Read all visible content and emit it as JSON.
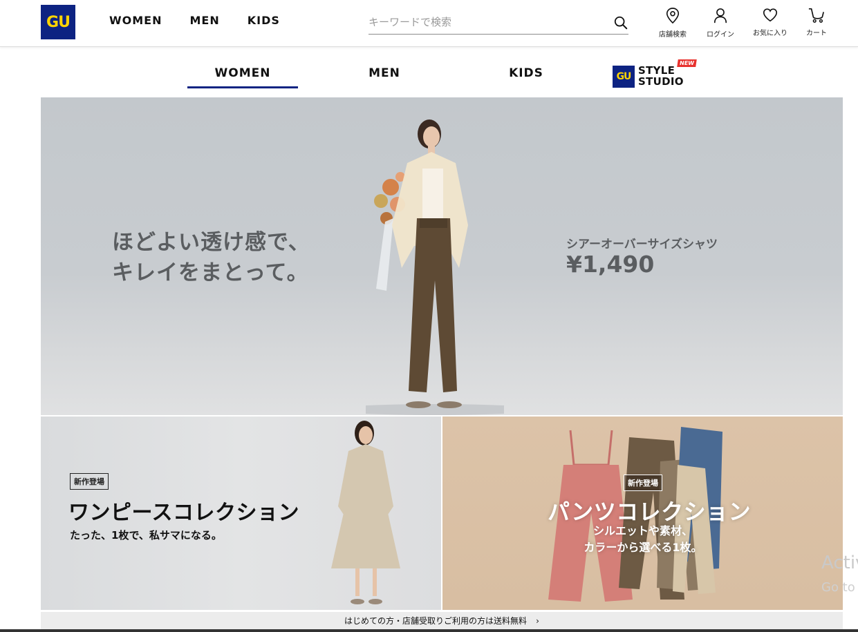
{
  "header": {
    "logo": "GU",
    "nav": [
      "WOMEN",
      "MEN",
      "KIDS"
    ],
    "search_placeholder": "キーワードで検索",
    "utilities": [
      {
        "label": "店舗検索",
        "icon": "map-pin-icon"
      },
      {
        "label": "ログイン",
        "icon": "user-icon"
      },
      {
        "label": "お気に入り",
        "icon": "heart-icon"
      },
      {
        "label": "カート",
        "icon": "cart-icon"
      }
    ]
  },
  "subnav": {
    "tabs": [
      "WOMEN",
      "MEN",
      "KIDS"
    ],
    "active_tab": "WOMEN",
    "style_studio": {
      "logo": "GU",
      "line1": "STYLE",
      "line2": "STUDIO",
      "badge": "NEW"
    }
  },
  "hero": {
    "copy_line1": "ほどよい透け感で、",
    "copy_line2": "キレイをまとって。",
    "product_name": "シアーオーバーサイズシャツ",
    "price": "¥1,490"
  },
  "tiles": [
    {
      "badge": "新作登場",
      "title": "ワンピースコレクション",
      "subtitle": "たった、1枚で、私サマになる。"
    },
    {
      "badge": "新作登場",
      "title": "パンツコレクション",
      "subtitle_line1": "シルエットや素材、",
      "subtitle_line2": "カラーから選べる1枚。"
    }
  ],
  "shipping_bar": {
    "text": "はじめての方・店舗受取りご利用の方は送料無料",
    "arrow": "›"
  },
  "watermark": {
    "line1": "Activ",
    "line2": "Go to"
  },
  "colors": {
    "brand_navy": "#0d2382",
    "brand_yellow": "#ffd400",
    "new_badge": "#e8322e"
  }
}
